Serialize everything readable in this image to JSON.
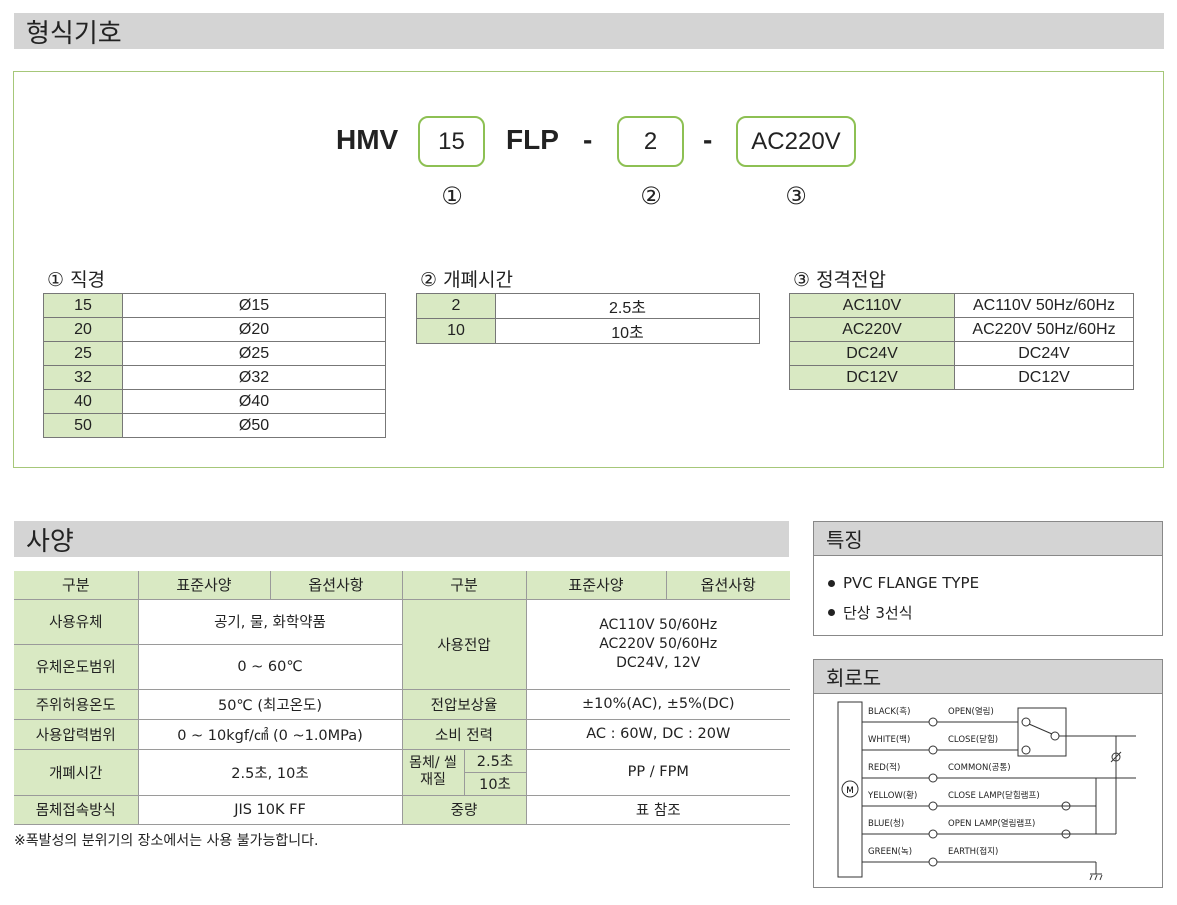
{
  "model": {
    "title": "형식기호",
    "prefix": "HMV",
    "size": "15",
    "type": "FLP",
    "dash1": "-",
    "cable": "2",
    "dash2": "-",
    "voltage": "AC220V",
    "marks": [
      "①",
      "②",
      "③"
    ]
  },
  "diameter": {
    "heading": "① 직경",
    "rows": [
      [
        "15",
        "Ø15"
      ],
      [
        "20",
        "Ø20"
      ],
      [
        "25",
        "Ø25"
      ],
      [
        "32",
        "Ø32"
      ],
      [
        "40",
        "Ø40"
      ],
      [
        "50",
        "Ø50"
      ]
    ]
  },
  "opentime": {
    "heading": "② 개폐시간",
    "rows": [
      [
        "2",
        "2.5초"
      ],
      [
        "10",
        "10초"
      ]
    ]
  },
  "ratedvolt": {
    "heading": "③ 정격전압",
    "rows": [
      [
        "AC110V",
        "AC110V 50Hz/60Hz"
      ],
      [
        "AC220V",
        "AC220V 50Hz/60Hz"
      ],
      [
        "DC24V",
        "DC24V"
      ],
      [
        "DC12V",
        "DC12V"
      ]
    ]
  },
  "spec": {
    "title": "사양",
    "headers": [
      "구분",
      "표준사양",
      "옵션사항",
      "구분",
      "표준사양",
      "옵션사항"
    ],
    "fluid_label": "사용유체",
    "fluid_value": "공기, 물, 화학약품",
    "fluidtemp_label": "유체온도범위",
    "fluidtemp_value": "0 ~ 60℃",
    "supply_label": "사용전압",
    "supply_value1": "AC110V 50/60Hz",
    "supply_value2": "AC220V 50/60Hz",
    "supply_value3": "DC24V, 12V",
    "ambient_label": "주위허용온도",
    "ambient_value": "50℃ (최고온도)",
    "comp_label": "전압보상율",
    "comp_value": "±10%(AC), ±5%(DC)",
    "pressure_label": "사용압력범위",
    "pressure_value": "0 ~ 10kgf/㎠ (0 ~1.0MPa)",
    "power_label": "소비 전력",
    "power_value": "AC : 60W, DC : 20W",
    "time_label": "개폐시간",
    "time_value": "2.5초, 10초",
    "body_label": "몸체/ 씰 재질",
    "body_sub1": "2.5초",
    "body_sub2": "10초",
    "body_value": "PP / FPM",
    "conn_label": "몸체접속방식",
    "conn_value": "JIS 10K FF",
    "weight_label": "중량",
    "weight_value": "표 참조",
    "note": "※폭발성의 분위기의 장소에서는 사용 불가능합니다."
  },
  "features": {
    "title": "특징",
    "items": [
      "PVC FLANGE TYPE",
      "단상 3선식"
    ]
  },
  "circuit": {
    "title": "회로도",
    "motor": "M",
    "wires": [
      [
        "BLACK(흑)",
        "OPEN(열림)"
      ],
      [
        "WHITE(백)",
        "CLOSE(닫힘)"
      ],
      [
        "RED(적)",
        "COMMON(공통)"
      ],
      [
        "YELLOW(황)",
        "CLOSE LAMP(닫힘램프)"
      ],
      [
        "BLUE(청)",
        "OPEN LAMP(열림램프)"
      ],
      [
        "GREEN(녹)",
        "EARTH(접지)"
      ]
    ]
  },
  "colors": {
    "accent_green": "#8dc053",
    "table_key_bg": "#d9e9c3",
    "bar_gray": "#d4d4d4"
  }
}
